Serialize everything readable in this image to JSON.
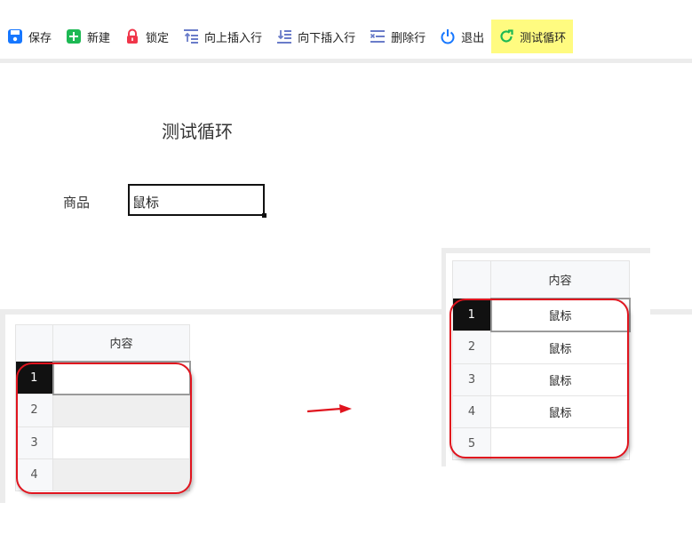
{
  "toolbar": {
    "buttons": [
      {
        "label": "保存",
        "icon": "save-icon",
        "color": "#1677ff"
      },
      {
        "label": "新建",
        "icon": "add-icon",
        "color": "#1db954"
      },
      {
        "label": "锁定",
        "icon": "lock-icon",
        "color": "#f0364a"
      },
      {
        "label": "向上插入行",
        "icon": "insert-row-above-icon",
        "color": "#6a7cc9"
      },
      {
        "label": "向下插入行",
        "icon": "insert-row-below-icon",
        "color": "#6a7cc9"
      },
      {
        "label": "删除行",
        "icon": "delete-row-icon",
        "color": "#6a7cc9"
      },
      {
        "label": "退出",
        "icon": "power-icon",
        "color": "#1677ff"
      },
      {
        "label": "测试循环",
        "icon": "refresh-icon",
        "color": "#1db954"
      }
    ],
    "active_highlight": "#fffb80"
  },
  "form": {
    "title": "测试循环",
    "field_label": "商品",
    "field_value": "鼠标"
  },
  "grid_before": {
    "column_header": "内容",
    "rows": [
      {
        "num": "1",
        "value": ""
      },
      {
        "num": "2",
        "value": ""
      },
      {
        "num": "3",
        "value": ""
      },
      {
        "num": "4",
        "value": ""
      }
    ]
  },
  "grid_after": {
    "column_header": "内容",
    "rows": [
      {
        "num": "1",
        "value": "鼠标"
      },
      {
        "num": "2",
        "value": "鼠标"
      },
      {
        "num": "3",
        "value": "鼠标"
      },
      {
        "num": "4",
        "value": "鼠标"
      },
      {
        "num": "5",
        "value": ""
      }
    ]
  },
  "annotation_color": "#e0141e"
}
